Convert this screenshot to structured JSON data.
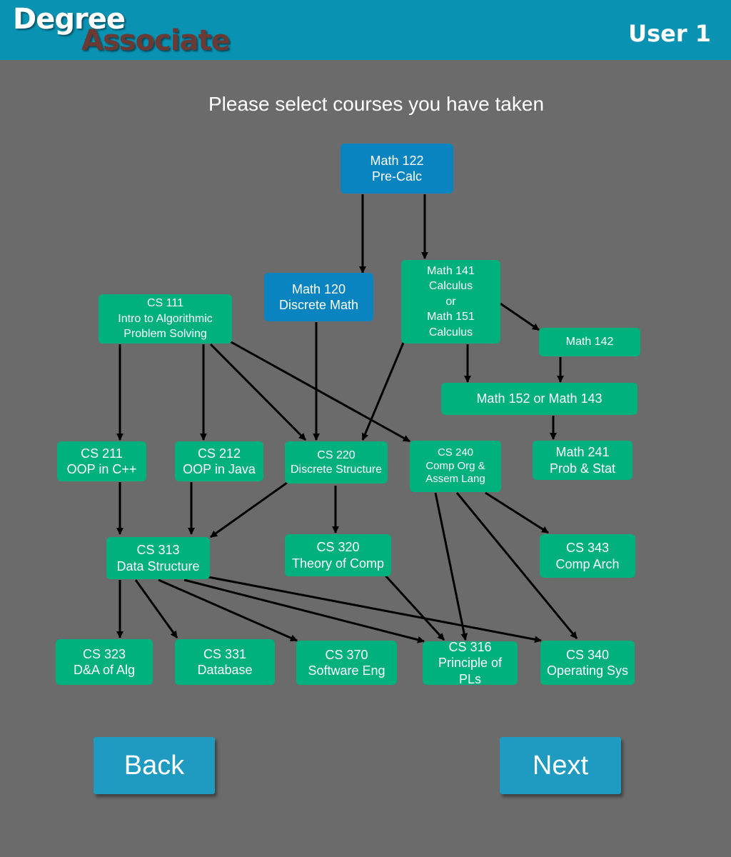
{
  "header": {
    "logo_line1": "Degree",
    "logo_line2": "Associate",
    "user": "User 1"
  },
  "prompt": "Please select courses you have taken",
  "courses": {
    "math122": "Math 122\nPre-Calc",
    "math120": "Math 120\nDiscrete Math",
    "math141": "Math 141\nCalculus\nor\nMath 151\nCalculus",
    "math142": "Math 142",
    "cs111": "CS 111\nIntro to Algorithmic\nProblem Solving",
    "math152": "Math 152 or Math 143",
    "cs211": "CS 211\nOOP in C++",
    "cs212": "CS 212\nOOP in Java",
    "cs220": "CS 220\nDiscrete Structure",
    "cs240": "CS 240\nComp Org &\nAssem Lang",
    "math241": "Math 241\nProb & Stat",
    "cs313": "CS 313\nData Structure",
    "cs320": "CS 320\nTheory of Comp",
    "cs343": "CS 343\nComp Arch",
    "cs323": "CS 323\nD&A of Alg",
    "cs331": "CS 331\nDatabase",
    "cs370": "CS 370\nSoftware Eng",
    "cs316": "CS 316\nPrinciple of PLs",
    "cs340": "CS 340\nOperating Sys"
  },
  "colors": {
    "header": "#0a92b3",
    "background": "#6b6b6b",
    "course_available": "#00b07d",
    "course_selected": "#0a84c0",
    "button": "#1f9bc2"
  },
  "buttons": {
    "back": "Back",
    "next": "Next"
  }
}
